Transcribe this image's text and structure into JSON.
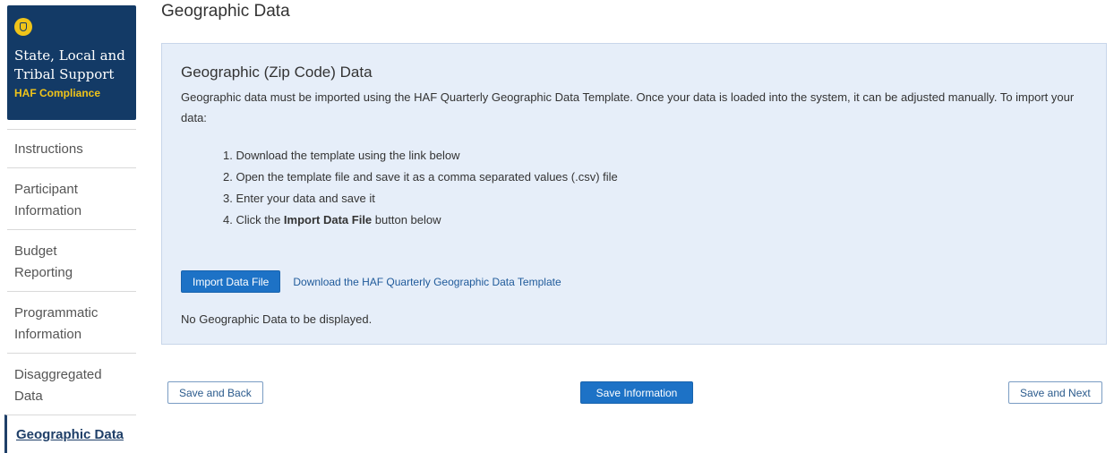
{
  "sidebar": {
    "brand": {
      "title_line1": "State, Local and",
      "title_line2": "Tribal Support",
      "subtitle": "HAF Compliance"
    },
    "items": [
      {
        "label_line1": "Instructions",
        "label_line2": ""
      },
      {
        "label_line1": "Participant",
        "label_line2": "Information"
      },
      {
        "label_line1": "Budget",
        "label_line2": "Reporting"
      },
      {
        "label_line1": "Programmatic",
        "label_line2": "Information"
      },
      {
        "label_line1": "Disaggregated",
        "label_line2": "Data"
      },
      {
        "label_line1": "Geographic Data",
        "label_line2": ""
      }
    ],
    "active_item": "Geographic Data"
  },
  "page": {
    "title": "Geographic Data"
  },
  "panel": {
    "title": "Geographic (Zip Code) Data",
    "intro": "Geographic data must be imported using the HAF Quarterly Geographic Data Template. Once your data is loaded into the system, it can be adjusted manually. To import your data:",
    "steps": [
      "1. Download the template using the link below",
      "2. Open the template file and save it as a comma separated values (.csv) file",
      "3. Enter your data and save it"
    ],
    "step4_prefix": "4. Click the ",
    "step4_bold": "Import Data File",
    "step4_suffix": " button below",
    "import_button": "Import Data File",
    "download_link": "Download the HAF Quarterly Geographic Data Template",
    "empty_message": "No Geographic Data to be displayed."
  },
  "footer": {
    "back_button": "Save and Back",
    "save_button": "Save Information",
    "next_button": "Save and Next"
  },
  "colors": {
    "brand_bg": "#133a66",
    "brand_accent": "#f0c419",
    "panel_bg": "#e6eef9",
    "primary_button": "#1d72c6"
  }
}
